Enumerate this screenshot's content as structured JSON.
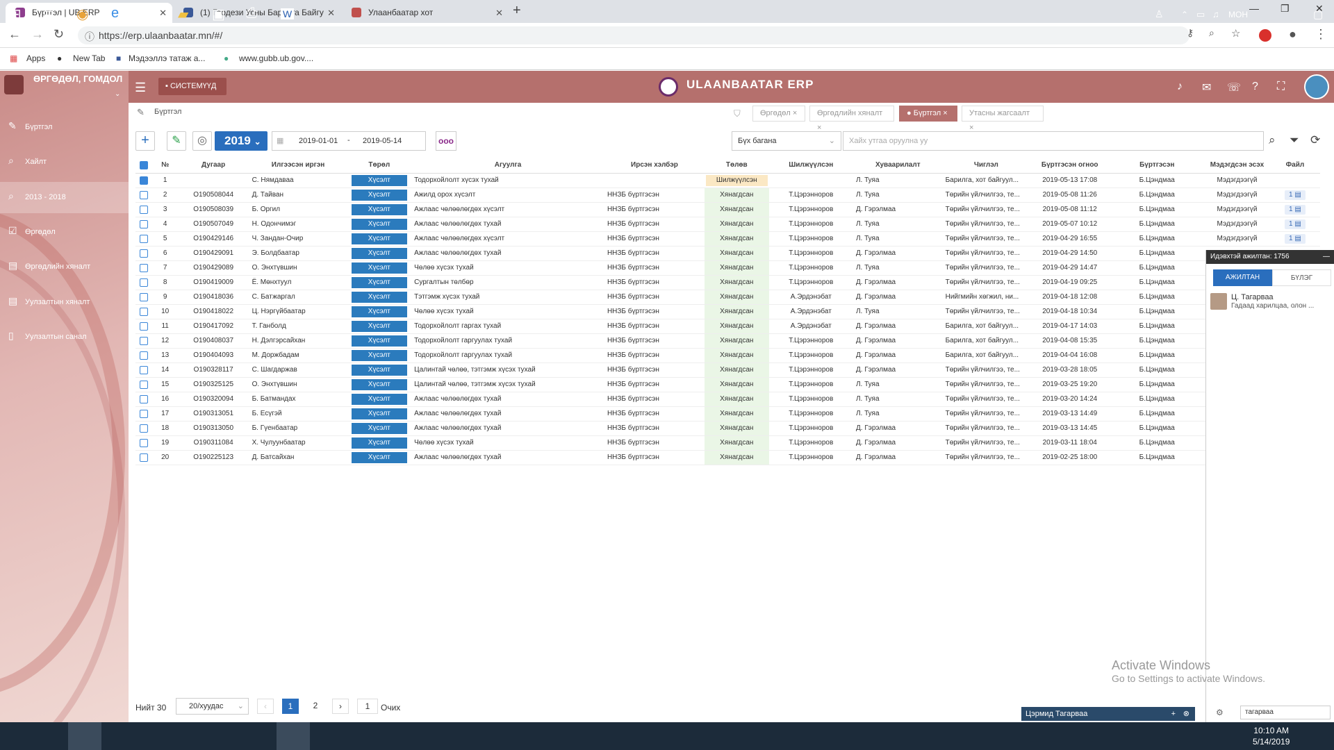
{
  "browser": {
    "tabs": [
      {
        "label": "Бүртгэл | UB ERP"
      },
      {
        "label": "(1) Геодези Усны Барилга Байгу"
      },
      {
        "label": "Улаанбаатар хот"
      }
    ],
    "url": "https://erp.ulaanbaatar.mn/#/",
    "bookmarks": [
      "Apps",
      "New Tab",
      "Мэдээллэ татаж а...",
      "www.gubb.ub.gov...."
    ]
  },
  "app": {
    "module_title": "ӨРГӨДӨЛ, ГОМДОЛ",
    "system_button": "СИСТЕМҮҮД",
    "brand": "ULAANBAATAR ERP",
    "accent_color": "#b5706d",
    "primary_color": "#2a6ebd"
  },
  "sidebar": {
    "items": [
      {
        "label": "Бүртгэл",
        "icon": "edit-icon"
      },
      {
        "label": "Хайлт",
        "icon": "search-icon"
      },
      {
        "label": "2013 - 2018",
        "icon": "search-icon"
      },
      {
        "label": "Өргөдөл",
        "icon": "checkbox-icon"
      },
      {
        "label": "Өргөдлийн хяналт",
        "icon": "list-icon"
      },
      {
        "label": "Уулзалтын хяналт",
        "icon": "list-icon"
      },
      {
        "label": "Уулзалтын санал",
        "icon": "file-icon"
      }
    ]
  },
  "breadcrumb": "Бүртгэл",
  "quick_tabs": [
    {
      "label": "Өргөдөл",
      "active": false
    },
    {
      "label": "Өргөдлийн хяналт",
      "active": false
    },
    {
      "label": "Бүртгэл",
      "active": true
    },
    {
      "label": "Утасны жагсаалт",
      "active": false
    }
  ],
  "toolbar": {
    "year": "2019",
    "date_from": "2019-01-01",
    "date_sep": "-",
    "date_to": "2019-05-14",
    "more": "ooo",
    "column_select": "Бүх багана",
    "search_placeholder": "Хайх утгаа оруулна уу"
  },
  "table": {
    "columns": [
      "№",
      "Дугаар",
      "Илгээсэн иргэн",
      "Төрөл",
      "Агуулга",
      "Ирсэн хэлбэр",
      "Төлөв",
      "Шилжүүлсэн",
      "Хуваарилалт",
      "Чиглэл",
      "Бүртгэсэн огноо",
      "Бүртгэсэн",
      "Мэдэгдсэн эсэх",
      "Файл"
    ],
    "rows": [
      {
        "n": "1",
        "num": "",
        "sender": "С. Нямдаваа",
        "type": "Хүсэлт",
        "content": "Тодорхойлолт хүсэх тухай",
        "form": "",
        "status": "Шилжүүлсэн",
        "transfer": "",
        "assign": "Л. Туяа",
        "dir": "Барилга, хот байгуул...",
        "date": "2019-05-13 17:08",
        "reg": "Б.Цэндмаа",
        "notified": "Мэдэгдээгүй",
        "file": ""
      },
      {
        "n": "2",
        "num": "О190508044",
        "sender": "Д. Тайван",
        "type": "Хүсэлт",
        "content": "Ажилд орох хүсэлт",
        "form": "ННЗБ бүртгэсэн",
        "status": "Хянагдсан",
        "transfer": "Т.Цэрэнноров",
        "assign": "Л. Туяа",
        "dir": "Төрийн үйлчилгээ, те...",
        "date": "2019-05-08 11:26",
        "reg": "Б.Цэндмаа",
        "notified": "Мэдэгдээгүй",
        "file": "1"
      },
      {
        "n": "3",
        "num": "О190508039",
        "sender": "Б. Оргил",
        "type": "Хүсэлт",
        "content": "Ажлаас чөлөөлөгдөх хүсэлт",
        "form": "ННЗБ бүртгэсэн",
        "status": "Хянагдсан",
        "transfer": "Т.Цэрэнноров",
        "assign": "Д. Гэрэлмаа",
        "dir": "Төрийн үйлчилгээ, те...",
        "date": "2019-05-08 11:12",
        "reg": "Б.Цэндмаа",
        "notified": "Мэдэгдээгүй",
        "file": "1"
      },
      {
        "n": "4",
        "num": "О190507049",
        "sender": "Н. Одончимэг",
        "type": "Хүсэлт",
        "content": "Ажлаас чөлөөлөгдөх тухай",
        "form": "ННЗБ бүртгэсэн",
        "status": "Хянагдсан",
        "transfer": "Т.Цэрэнноров",
        "assign": "Л. Туяа",
        "dir": "Төрийн үйлчилгээ, те...",
        "date": "2019-05-07 10:12",
        "reg": "Б.Цэндмаа",
        "notified": "Мэдэгдээгүй",
        "file": "1"
      },
      {
        "n": "5",
        "num": "О190429146",
        "sender": "Ч. Зандан-Очир",
        "type": "Хүсэлт",
        "content": "Ажлаас чөлөөлөгдөх хүсэлт",
        "form": "ННЗБ бүртгэсэн",
        "status": "Хянагдсан",
        "transfer": "Т.Цэрэнноров",
        "assign": "Л. Туяа",
        "dir": "Төрийн үйлчилгээ, те...",
        "date": "2019-04-29 16:55",
        "reg": "Б.Цэндмаа",
        "notified": "Мэдэгдээгүй",
        "file": "1"
      },
      {
        "n": "6",
        "num": "О190429091",
        "sender": "Э. Болдбаатар",
        "type": "Хүсэлт",
        "content": "Ажлаас чөлөөлөгдөх тухай",
        "form": "ННЗБ бүртгэсэн",
        "status": "Хянагдсан",
        "transfer": "Т.Цэрэнноров",
        "assign": "Д. Гэрэлмаа",
        "dir": "Төрийн үйлчилгээ, те...",
        "date": "2019-04-29 14:50",
        "reg": "Б.Цэндмаа",
        "notified": "",
        "file": ""
      },
      {
        "n": "7",
        "num": "О190429089",
        "sender": "О. Энхтүвшин",
        "type": "Хүсэлт",
        "content": "Чөлөө хүсэх тухай",
        "form": "ННЗБ бүртгэсэн",
        "status": "Хянагдсан",
        "transfer": "Т.Цэрэнноров",
        "assign": "Л. Туяа",
        "dir": "Төрийн үйлчилгээ, те...",
        "date": "2019-04-29 14:47",
        "reg": "Б.Цэндмаа",
        "notified": "",
        "file": ""
      },
      {
        "n": "8",
        "num": "О190419009",
        "sender": "Ё. Мөнхтуул",
        "type": "Хүсэлт",
        "content": "Сургалтын төлбөр",
        "form": "ННЗБ бүртгэсэн",
        "status": "Хянагдсан",
        "transfer": "Т.Цэрэнноров",
        "assign": "Д. Гэрэлмаа",
        "dir": "Төрийн үйлчилгээ, те...",
        "date": "2019-04-19 09:25",
        "reg": "Б.Цэндмаа",
        "notified": "",
        "file": ""
      },
      {
        "n": "9",
        "num": "О190418036",
        "sender": "С. Батжаргал",
        "type": "Хүсэлт",
        "content": "Тэтгэмж хүсэх тухай",
        "form": "ННЗБ бүртгэсэн",
        "status": "Хянагдсан",
        "transfer": "А.Эрдэнэбат",
        "assign": "Д. Гэрэлмаа",
        "dir": "Нийгмийн хөгжил, ни...",
        "date": "2019-04-18 12:08",
        "reg": "Б.Цэндмаа",
        "notified": "",
        "file": ""
      },
      {
        "n": "10",
        "num": "О190418022",
        "sender": "Ц. Нэргүйбаатар",
        "type": "Хүсэлт",
        "content": "Чөлөө хүсэх тухай",
        "form": "ННЗБ бүртгэсэн",
        "status": "Хянагдсан",
        "transfer": "А.Эрдэнэбат",
        "assign": "Л. Туяа",
        "dir": "Төрийн үйлчилгээ, те...",
        "date": "2019-04-18 10:34",
        "reg": "Б.Цэндмаа",
        "notified": "",
        "file": ""
      },
      {
        "n": "11",
        "num": "О190417092",
        "sender": "Т. Ганболд",
        "type": "Хүсэлт",
        "content": "Тодорхойлолт гаргах тухай",
        "form": "ННЗБ бүртгэсэн",
        "status": "Хянагдсан",
        "transfer": "А.Эрдэнэбат",
        "assign": "Д. Гэрэлмаа",
        "dir": "Барилга, хот байгуул...",
        "date": "2019-04-17 14:03",
        "reg": "Б.Цэндмаа",
        "notified": "",
        "file": ""
      },
      {
        "n": "12",
        "num": "О190408037",
        "sender": "Н. Дэлгэрсайхан",
        "type": "Хүсэлт",
        "content": "Тодорхойлолт гаргуулах тухай",
        "form": "ННЗБ бүртгэсэн",
        "status": "Хянагдсан",
        "transfer": "Т.Цэрэнноров",
        "assign": "Д. Гэрэлмаа",
        "dir": "Барилга, хот байгуул...",
        "date": "2019-04-08 15:35",
        "reg": "Б.Цэндмаа",
        "notified": "",
        "file": ""
      },
      {
        "n": "13",
        "num": "О190404093",
        "sender": "М. Доржбадам",
        "type": "Хүсэлт",
        "content": "Тодорхойлолт гаргуулах тухай",
        "form": "ННЗБ бүртгэсэн",
        "status": "Хянагдсан",
        "transfer": "Т.Цэрэнноров",
        "assign": "Д. Гэрэлмаа",
        "dir": "Барилга, хот байгуул...",
        "date": "2019-04-04 16:08",
        "reg": "Б.Цэндмаа",
        "notified": "",
        "file": ""
      },
      {
        "n": "14",
        "num": "О190328117",
        "sender": "С. Шагдаржав",
        "type": "Хүсэлт",
        "content": "Цалинтай чөлөө, тэтгэмж хүсэх тухай",
        "form": "ННЗБ бүртгэсэн",
        "status": "Хянагдсан",
        "transfer": "Т.Цэрэнноров",
        "assign": "Д. Гэрэлмаа",
        "dir": "Төрийн үйлчилгээ, те...",
        "date": "2019-03-28 18:05",
        "reg": "Б.Цэндмаа",
        "notified": "",
        "file": ""
      },
      {
        "n": "15",
        "num": "О190325125",
        "sender": "О. Энхтүвшин",
        "type": "Хүсэлт",
        "content": "Цалинтай чөлөө, тэтгэмж хүсэх тухай",
        "form": "ННЗБ бүртгэсэн",
        "status": "Хянагдсан",
        "transfer": "Т.Цэрэнноров",
        "assign": "Л. Туяа",
        "dir": "Төрийн үйлчилгээ, те...",
        "date": "2019-03-25 19:20",
        "reg": "Б.Цэндмаа",
        "notified": "",
        "file": ""
      },
      {
        "n": "16",
        "num": "О190320094",
        "sender": "Б. Батмандах",
        "type": "Хүсэлт",
        "content": "Ажлаас чөлөөлөгдөх тухай",
        "form": "ННЗБ бүртгэсэн",
        "status": "Хянагдсан",
        "transfer": "Т.Цэрэнноров",
        "assign": "Л. Туяа",
        "dir": "Төрийн үйлчилгээ, те...",
        "date": "2019-03-20 14:24",
        "reg": "Б.Цэндмаа",
        "notified": "",
        "file": ""
      },
      {
        "n": "17",
        "num": "О190313051",
        "sender": "Б. Есүгэй",
        "type": "Хүсэлт",
        "content": "Ажлаас чөлөөлөгдөх тухай",
        "form": "ННЗБ бүртгэсэн",
        "status": "Хянагдсан",
        "transfer": "Т.Цэрэнноров",
        "assign": "Л. Туяа",
        "dir": "Төрийн үйлчилгээ, те...",
        "date": "2019-03-13 14:49",
        "reg": "Б.Цэндмаа",
        "notified": "",
        "file": ""
      },
      {
        "n": "18",
        "num": "О190313050",
        "sender": "Б. Гүенбаатар",
        "type": "Хүсэлт",
        "content": "Ажлаас чөлөөлөгдөх тухай",
        "form": "ННЗБ бүртгэсэн",
        "status": "Хянагдсан",
        "transfer": "Т.Цэрэнноров",
        "assign": "Д. Гэрэлмаа",
        "dir": "Төрийн үйлчилгээ, те...",
        "date": "2019-03-13 14:45",
        "reg": "Б.Цэндмаа",
        "notified": "",
        "file": ""
      },
      {
        "n": "19",
        "num": "О190311084",
        "sender": "Х. Чулуунбаатар",
        "type": "Хүсэлт",
        "content": "Чөлөө хүсэх тухай",
        "form": "ННЗБ бүртгэсэн",
        "status": "Хянагдсан",
        "transfer": "Т.Цэрэнноров",
        "assign": "Д. Гэрэлмаа",
        "dir": "Төрийн үйлчилгээ, те...",
        "date": "2019-03-11 18:04",
        "reg": "Б.Цэндмаа",
        "notified": "",
        "file": ""
      },
      {
        "n": "20",
        "num": "О190225123",
        "sender": "Д. Батсайхан",
        "type": "Хүсэлт",
        "content": "Ажлаас чөлөөлөгдөх тухай",
        "form": "ННЗБ бүртгэсэн",
        "status": "Хянагдсан",
        "transfer": "Т.Цэрэнноров",
        "assign": "Д. Гэрэлмаа",
        "dir": "Төрийн үйлчилгээ, те...",
        "date": "2019-02-25 18:00",
        "reg": "Б.Цэндмаа",
        "notified": "",
        "file": ""
      }
    ]
  },
  "pagination": {
    "total_label": "Нийт 30",
    "page_size": "20/хуудас",
    "pages": [
      "1",
      "2"
    ],
    "current": "1",
    "goto_value": "1",
    "goto_label": "Очих"
  },
  "chat": {
    "header": "Идэвхтэй ажилтан: 1756",
    "tab_active": "АЖИЛТАН",
    "tab_other": "БҮЛЭГ",
    "user_name": "Ц. Тагарваа",
    "user_desc": "Гадаад харилцаа, олон ...",
    "bar_label": "Цэрмид Тагарваа",
    "search_value": "тагарваа"
  },
  "watermark": {
    "title": "Activate Windows",
    "subtitle": "Go to Settings to activate Windows."
  },
  "taskbar": {
    "lang": "МОН",
    "time": "10:10 AM",
    "date": "5/14/2019"
  }
}
